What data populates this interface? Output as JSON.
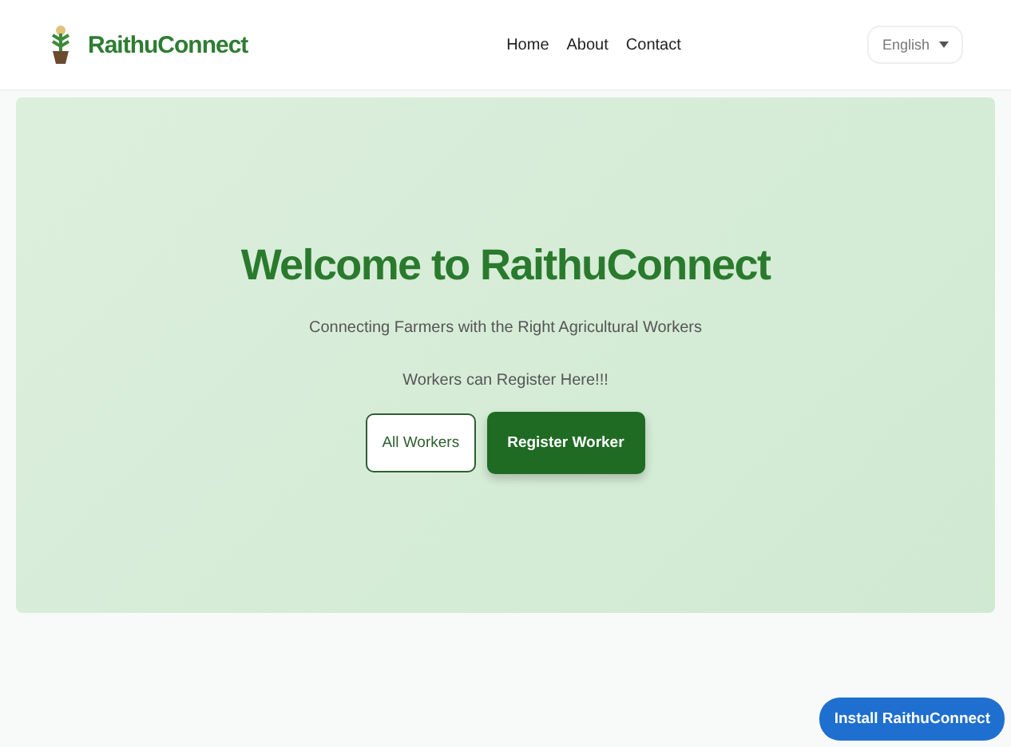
{
  "header": {
    "brand": "RaithuConnect",
    "nav": [
      {
        "label": "Home"
      },
      {
        "label": "About"
      },
      {
        "label": "Contact"
      }
    ],
    "language": "English"
  },
  "hero": {
    "title": "Welcome to RaithuConnect",
    "subtitle": "Connecting Farmers with the Right Agricultural Workers",
    "note": "Workers can Register Here!!!",
    "buttons": [
      {
        "label": "All Workers",
        "kind": "outline"
      },
      {
        "label": "Register Worker",
        "kind": "primary"
      }
    ]
  },
  "install_button": "Install RaithuConnect"
}
